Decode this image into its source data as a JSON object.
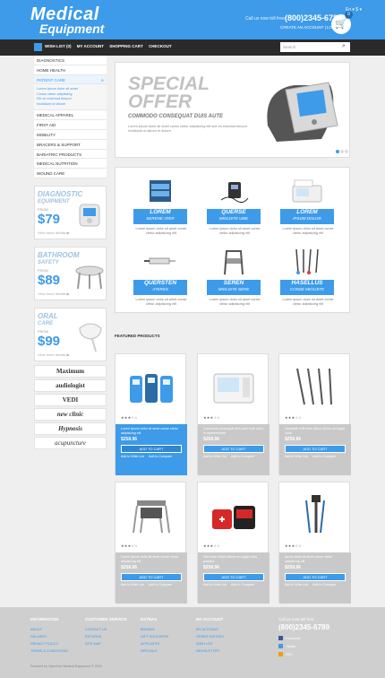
{
  "header": {
    "logo_line1": "Medical",
    "logo_line2": "Equipment",
    "lang": "En ▾  $ ▾",
    "call_label": "Call us now toll free:",
    "phone": "(800)2345-6789",
    "account_links": "CREATE AN ACCOUNT  |  LOGIN",
    "cart_count": "0",
    "cart_icon": "cart-icon",
    "accent": "#3d9be9"
  },
  "topnav": {
    "links": [
      "WISH LIST (0)",
      "MY ACCOUNT",
      "SHOPPING CART",
      "CHECKOUT"
    ],
    "search_placeholder": "Search"
  },
  "sidebar": {
    "categories": [
      "DIAGNOSTICS",
      "HOME HEALTH",
      "PATIENT CARE",
      "MEDICAL APPAREL",
      "FIRST AID",
      "MOBILITY",
      "BRACERS & SUPPORT",
      "BARIATRIC PRODUCTS",
      "MEDICAL NUTRITION",
      "WOUND CARE"
    ],
    "subcategories": [
      "Lorem ipsum dolor sit amet",
      "Conse ctetur adipiscing",
      "Elit do eiusmod tempor",
      "Incididunt ut labore"
    ]
  },
  "promos": [
    {
      "line1": "DIAGNOSTIC",
      "line2": "EQUIPMENT",
      "from": "FROM",
      "price": "$79",
      "more": "View more details ▶"
    },
    {
      "line1": "BATHROOM",
      "line2": "SAFETY",
      "from": "FROM",
      "price": "$89",
      "more": "View more details ▶"
    },
    {
      "line1": "ORAL",
      "line2": "CARE",
      "from": "FROM",
      "price": "$99",
      "more": "View more details ▶"
    }
  ],
  "brands": [
    "Maximum",
    "audiologist",
    "VEDI",
    "new clinic",
    "Hypnosis",
    "acupuncture"
  ],
  "slider": {
    "title1": "SPECIAL",
    "title2": "OFFER",
    "subtitle": "COMMODO CONSEQUAT DUIS AUTE",
    "desc": "Lorem ipsum dolor sit amet conse ctetur adipisicing elit sed do eiusmod tempor incididunt ut labore et dolore."
  },
  "categories_grid": [
    {
      "title": "LOREM",
      "sub": "SERENE ATER",
      "desc": "Lorem ipsum dolor sit amet conse ctetur adipisicing elit",
      "icon": "test-strips-icon"
    },
    {
      "title": "QUERSE",
      "sub": "MIOLISTE UME",
      "desc": "Lorem ipsum dolor sit amet conse ctetur adipisicing elit",
      "icon": "tens-device-icon"
    },
    {
      "title": "LOREM",
      "sub": "IPSUM DOLOR",
      "desc": "Lorem ipsum dolor sit amet conse ctetur adipisicing elit",
      "icon": "ecg-machine-icon"
    },
    {
      "title": "QUERSTEN",
      "sub": "ATERES",
      "desc": "Lorem ipsum dolor sit amet conse ctetur adipisicing elit",
      "icon": "syringe-icon"
    },
    {
      "title": "SEREN",
      "sub": "MIOLISTE SERE",
      "desc": "Lorem ipsum dolor sit amet conse ctetur adipisicing elit",
      "icon": "walker-icon"
    },
    {
      "title": "HASELLUS",
      "sub": "CONSE MIOLISTE",
      "desc": "Lorem ipsum dolor sit amet conse ctetur adipisicing elit",
      "icon": "cables-icon"
    }
  ],
  "featured_title": "FEATURED PRODUCTS",
  "products": [
    {
      "name": "Lorem ipsum dolor sit amet conse ctetur adipisicing elit",
      "price": "$258.96",
      "add": "ADD TO CART",
      "wish": "Add to Wish List",
      "compare": "Add to Compare",
      "icon": "glucometer-icon"
    },
    {
      "name": "Commodo consequat duis aute irure dolor in reprehenderit",
      "price": "$258.96",
      "add": "ADD TO CART",
      "wish": "Add to Wish List",
      "compare": "Add to Compare",
      "icon": "ecg-monitor-icon"
    },
    {
      "name": "Voluptate velit esse cillum dolore eu fugiat nulla",
      "price": "$258.96",
      "add": "ADD TO CART",
      "wish": "Add to Wish List",
      "compare": "Add to Compare",
      "icon": "syringes-icon"
    },
    {
      "name": "Lorem ipsum dolor sit amet conse ctetur adipisicing elit",
      "price": "$258.96",
      "add": "ADD TO CART",
      "wish": "Add to Wish List",
      "compare": "Add to Compare",
      "icon": "commode-chair-icon"
    },
    {
      "name": "Velit esse cillum dolore eu fugiat nulla pariatur",
      "price": "$258.96",
      "add": "ADD TO CART",
      "wish": "Add to Wish List",
      "compare": "Add to Compare",
      "icon": "first-aid-kit-icon"
    },
    {
      "name": "Ipsum dolor sit amet conse ctetur adipisicing elit",
      "price": "$258.96",
      "add": "ADD TO CART",
      "wish": "Add to Wish List",
      "compare": "Add to Compare",
      "icon": "crutch-icon"
    }
  ],
  "footer": {
    "columns": [
      {
        "title": "INFORMATION",
        "links": [
          "ABOUT",
          "DELIVERY",
          "PRIVACY POLICY",
          "TERMS & CONDITIONS"
        ]
      },
      {
        "title": "CUSTOMER SERVICE",
        "links": [
          "CONTACT US",
          "RETURNS",
          "SITE MAP"
        ]
      },
      {
        "title": "EXTRAS",
        "links": [
          "BRANDS",
          "GIFT VOUCHERS",
          "AFFILIATES",
          "SPECIALS"
        ]
      },
      {
        "title": "MY ACCOUNT",
        "links": [
          "MY ACCOUNT",
          "ORDER HISTORY",
          "WISH LIST",
          "NEWSLETTER"
        ]
      }
    ],
    "call_label": "Call us now toll free:",
    "phone": "(800)2345-6789",
    "social": [
      "Facebook",
      "Twitter",
      "RSS"
    ],
    "copyright": "Powered by OpenCart Medical Equipment © 2015"
  }
}
